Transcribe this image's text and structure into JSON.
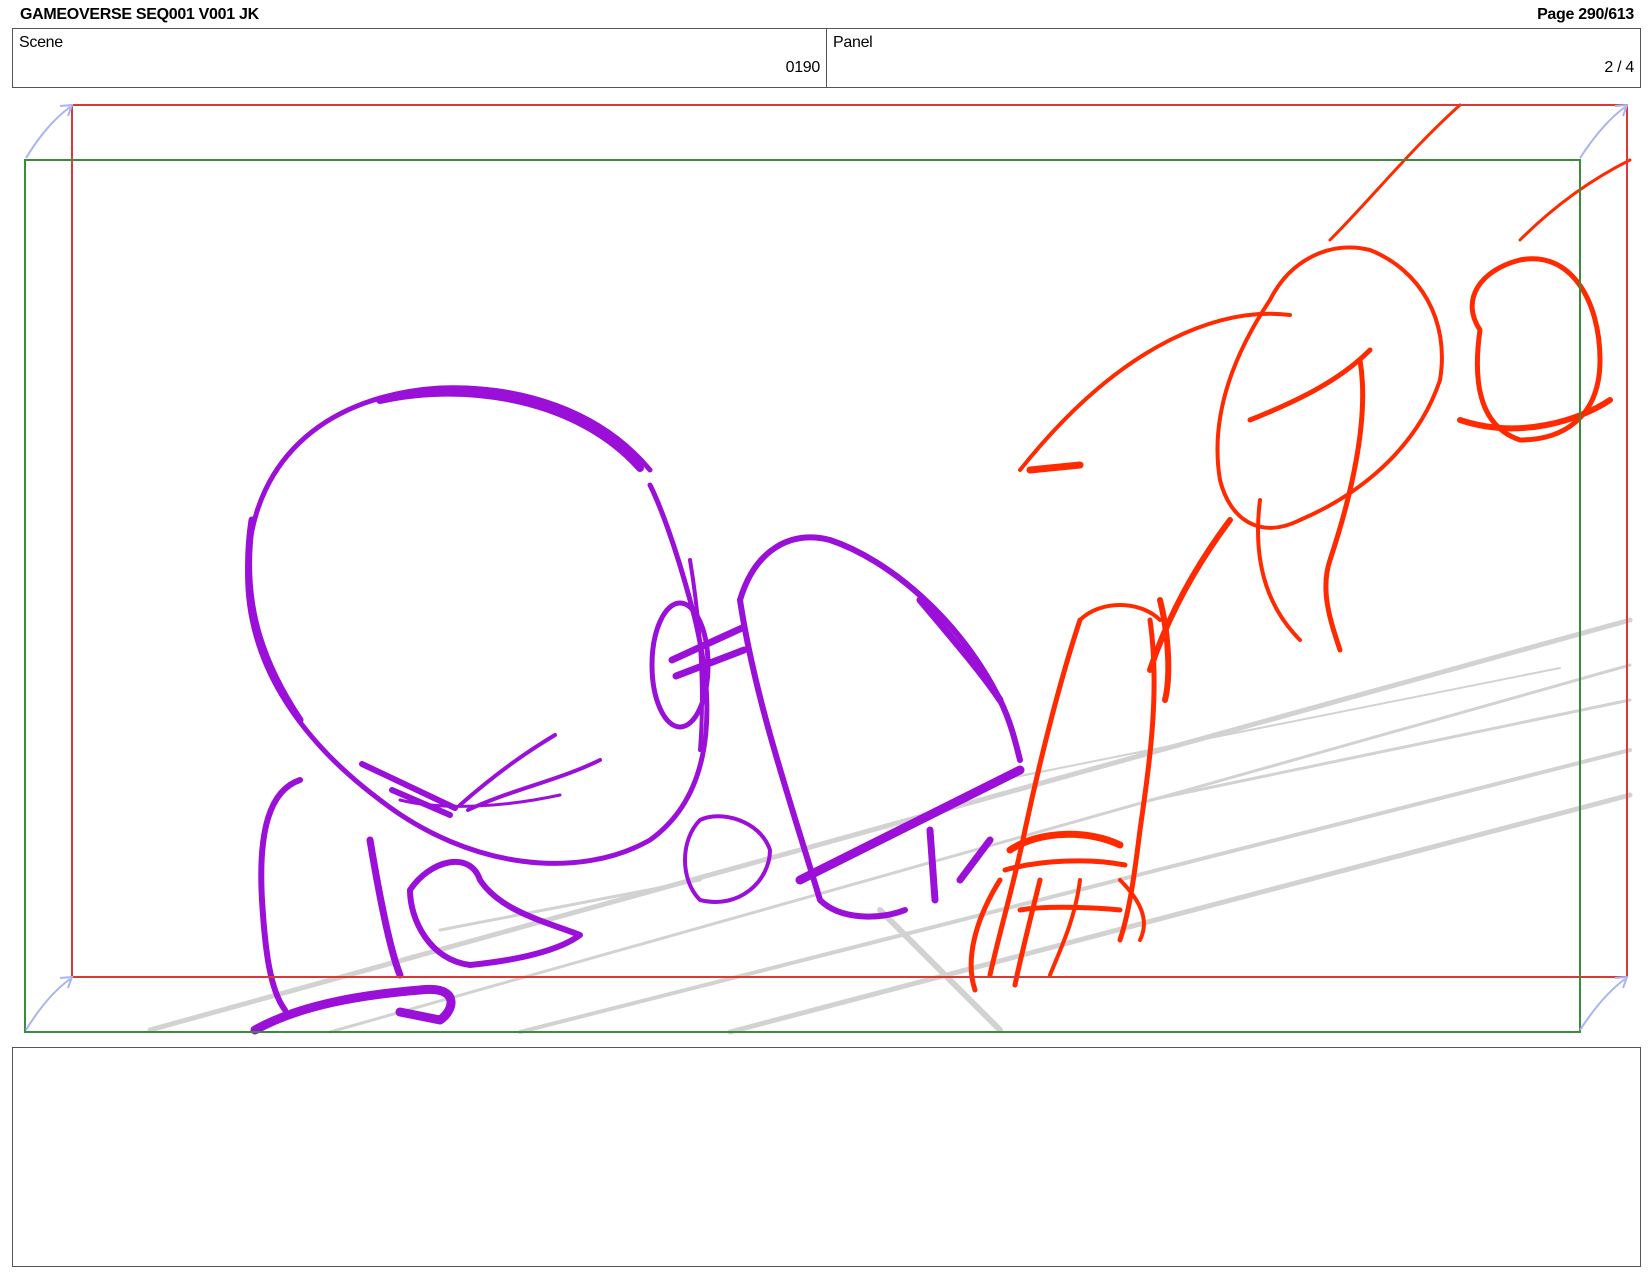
{
  "header": {
    "title": "GAMEOVERSE SEQ001 V001 JK",
    "page": "Page 290/613"
  },
  "scene": {
    "label": "Scene",
    "value": "0190"
  },
  "panel": {
    "label": "Panel",
    "value": "2 / 4"
  },
  "frame": {
    "colors": {
      "safe_frame": "#d83a3a",
      "camera_frame": "#3c8a3c",
      "corner_arrows": "#aab4ee",
      "figure_left": "#9a10d8",
      "figure_right": "#ff2a00",
      "background_lines": "#d2d2d2"
    }
  },
  "notes": {
    "text": ""
  }
}
